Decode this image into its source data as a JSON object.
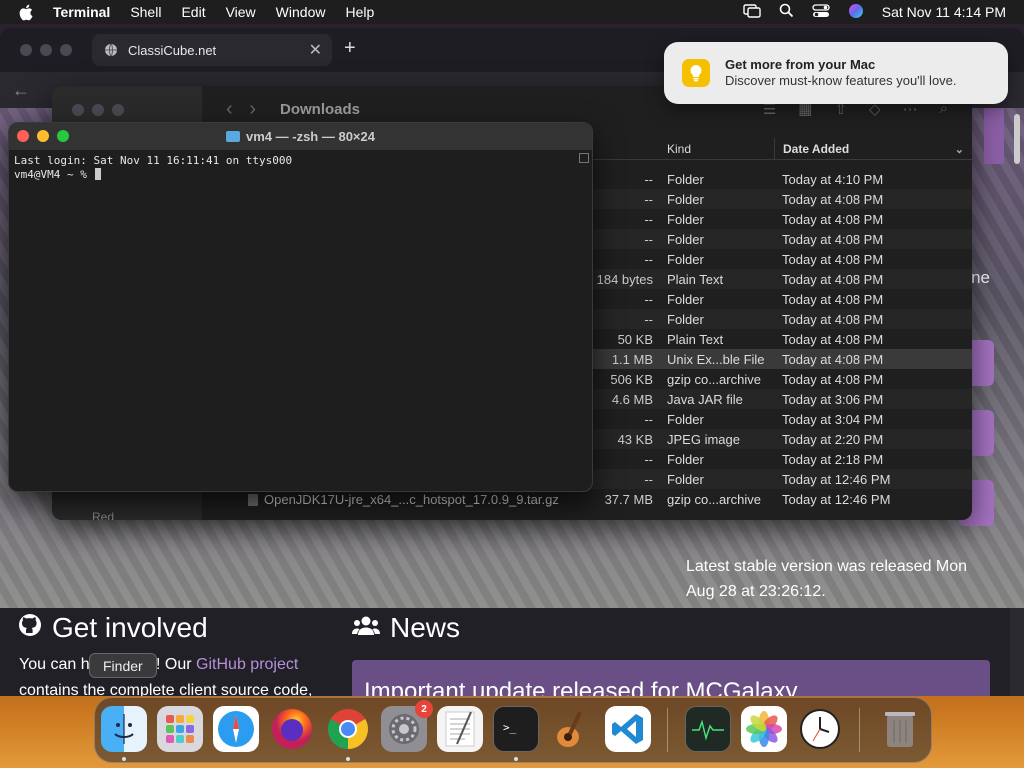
{
  "menubar": {
    "app_name": "Terminal",
    "items": [
      "Shell",
      "Edit",
      "View",
      "Window",
      "Help"
    ],
    "datetime": "Sat Nov 11  4:14 PM"
  },
  "browser": {
    "tab_title": "ClassiCube.net",
    "release_text": "Latest stable version was released Mon Aug 28 at 23:26:12.",
    "cut_text": "ne",
    "get_involved_title": "Get involved",
    "get_involved_text_a": "You can h",
    "get_involved_text_b": "t! Our ",
    "github_link": "GitHub project",
    "get_involved_text_c": "contains the complete client source code,",
    "news_title": "News",
    "news_card_title": "Important update released for MCGalaxy"
  },
  "finder": {
    "folder_title": "Downloads",
    "col_kind": "Kind",
    "col_date": "Date Added",
    "sidebar_tag": "Red",
    "rows": [
      {
        "name": "",
        "size": "--",
        "kind": "Folder",
        "date": "Today at 4:10 PM"
      },
      {
        "name": "",
        "size": "--",
        "kind": "Folder",
        "date": "Today at 4:08 PM"
      },
      {
        "name": "",
        "size": "--",
        "kind": "Folder",
        "date": "Today at 4:08 PM"
      },
      {
        "name": "",
        "size": "--",
        "kind": "Folder",
        "date": "Today at 4:08 PM"
      },
      {
        "name": "",
        "size": "--",
        "kind": "Folder",
        "date": "Today at 4:08 PM"
      },
      {
        "name": "",
        "size": "184 bytes",
        "kind": "Plain Text",
        "date": "Today at 4:08 PM"
      },
      {
        "name": "",
        "size": "--",
        "kind": "Folder",
        "date": "Today at 4:08 PM"
      },
      {
        "name": "",
        "size": "--",
        "kind": "Folder",
        "date": "Today at 4:08 PM"
      },
      {
        "name": "",
        "size": "50 KB",
        "kind": "Plain Text",
        "date": "Today at 4:08 PM"
      },
      {
        "name": "",
        "size": "1.1 MB",
        "kind": "Unix Ex...ble File",
        "date": "Today at 4:08 PM"
      },
      {
        "name": "",
        "size": "506 KB",
        "kind": "gzip co...archive",
        "date": "Today at 4:08 PM"
      },
      {
        "name": "",
        "size": "4.6 MB",
        "kind": "Java JAR file",
        "date": "Today at 3:06 PM"
      },
      {
        "name": "",
        "size": "--",
        "kind": "Folder",
        "date": "Today at 3:04 PM"
      },
      {
        "name": "",
        "size": "43 KB",
        "kind": "JPEG image",
        "date": "Today at 2:20 PM"
      },
      {
        "name": "",
        "size": "--",
        "kind": "Folder",
        "date": "Today at 2:18 PM"
      },
      {
        "name": "",
        "size": "--",
        "kind": "Folder",
        "date": "Today at 12:46 PM"
      },
      {
        "name": "OpenJDK17U-jre_x64_...c_hotspot_17.0.9_9.tar.gz",
        "size": "37.7 MB",
        "kind": "gzip co...archive",
        "date": "Today at 12:46 PM"
      }
    ]
  },
  "terminal": {
    "title": "vm4 — -zsh — 80×24",
    "line1": "Last login: Sat Nov 11 16:11:41 on ttys000",
    "prompt": "vm4@VM4 ~ % "
  },
  "notification": {
    "title": "Get more from your Mac",
    "body": "Discover must-know features you'll love."
  },
  "dock": {
    "tooltip": "Finder",
    "settings_badge": "2"
  }
}
